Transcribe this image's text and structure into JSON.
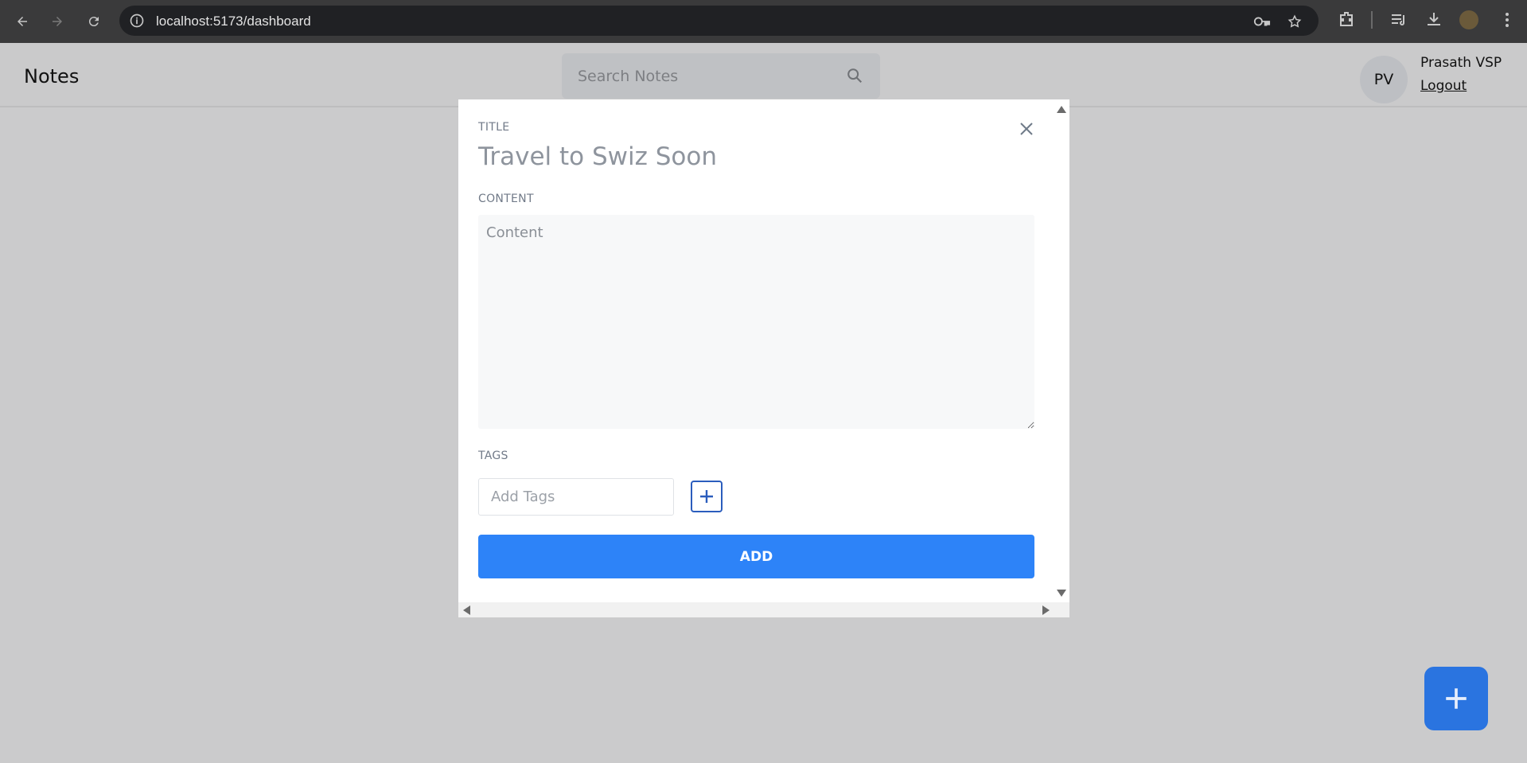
{
  "browser": {
    "url": "localhost:5173/dashboard"
  },
  "header": {
    "app_title": "Notes",
    "search": {
      "placeholder": "Search Notes"
    },
    "user": {
      "initials": "PV",
      "name": "Prasath VSP",
      "logout_label": "Logout"
    }
  },
  "modal": {
    "title_label": "TITLE",
    "title_value": "Travel to Swiz Soon",
    "content_label": "CONTENT",
    "content_placeholder": "Content",
    "tags_label": "TAGS",
    "tags_placeholder": "Add Tags",
    "add_label": "ADD"
  },
  "colors": {
    "primary": "#2d83f8",
    "fab": "#2a74e0",
    "overlay": "#cbcbcc"
  }
}
